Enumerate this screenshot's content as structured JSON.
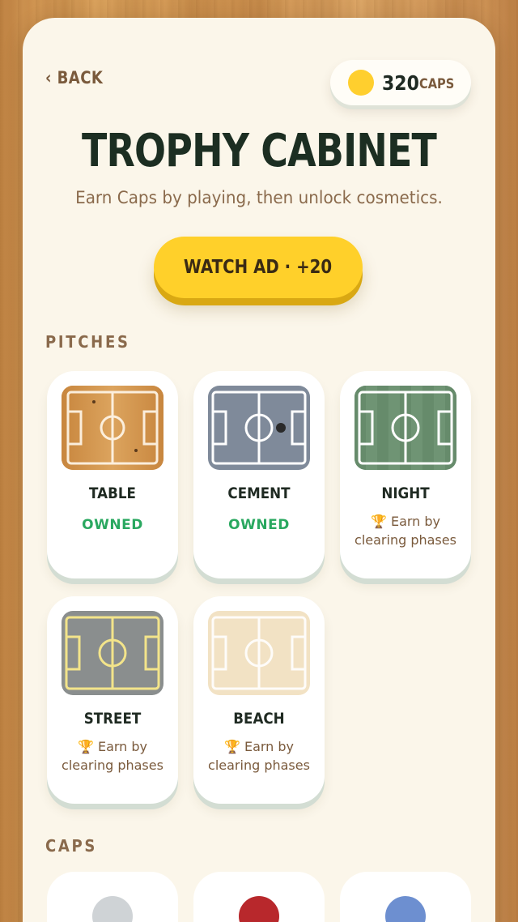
{
  "header": {
    "back_label": "‹ BACK",
    "caps_value": "320",
    "caps_unit": "CAPS",
    "coin_color": "#ffcf2e"
  },
  "title": "TROPHY CABINET",
  "subtitle": "Earn Caps by playing, then unlock cosmetics.",
  "watch_ad_label": "WATCH AD · +20",
  "sections": {
    "pitches": "PITCHES",
    "caps": "CAPS"
  },
  "pitches": [
    {
      "name": "TABLE",
      "status": "OWNED",
      "owned": true,
      "theme": "table"
    },
    {
      "name": "CEMENT",
      "status": "OWNED",
      "owned": true,
      "theme": "cement"
    },
    {
      "name": "NIGHT",
      "status": "🏆 Earn by clearing phases",
      "owned": false,
      "theme": "night"
    },
    {
      "name": "STREET",
      "status": "🏆 Earn by clearing phases",
      "owned": false,
      "theme": "street"
    },
    {
      "name": "BEACH",
      "status": "🏆 Earn by clearing phases",
      "owned": false,
      "theme": "beach"
    }
  ],
  "colors": {
    "owned": "#2aa860",
    "accent": "#ffd02a",
    "title": "#1c2e22",
    "brown": "#8a6a4c"
  },
  "cap_items": [
    {
      "icon": "silver-cap-icon",
      "color": "#cfd3d6"
    },
    {
      "icon": "red-cap-icon",
      "color": "#b8282c"
    },
    {
      "icon": "blue-cap-icon",
      "color": "#6d8fd0"
    }
  ]
}
